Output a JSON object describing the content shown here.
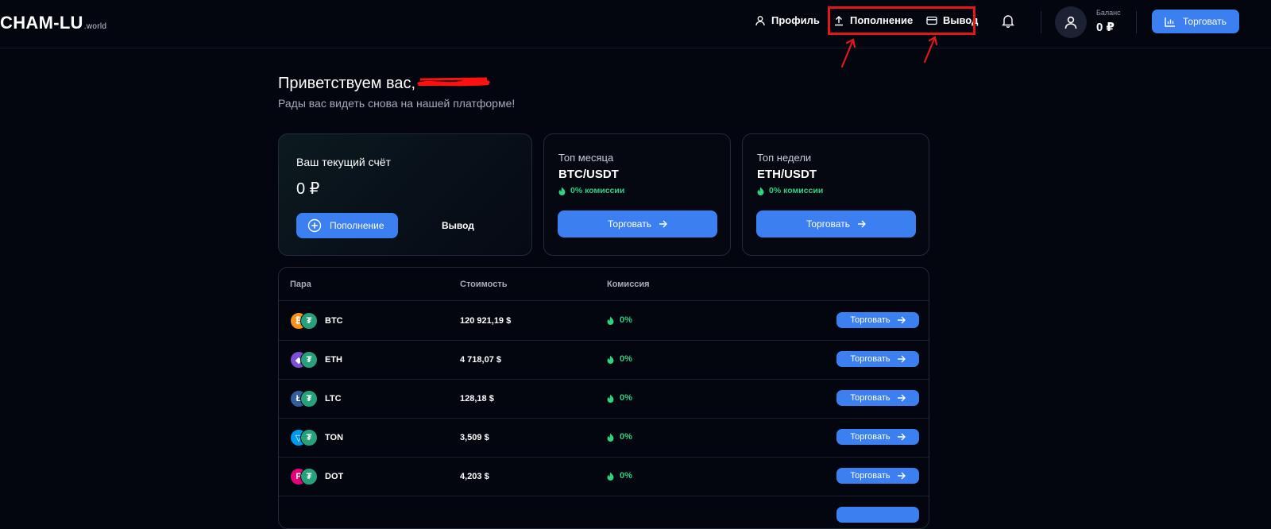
{
  "header": {
    "logo_main": "CHAM-LU",
    "logo_tld": ".world",
    "nav": {
      "profile_label": "Профиль",
      "deposit_label": "Пополнение",
      "withdraw_label": "Вывод"
    },
    "balance_label": "Баланс",
    "balance_value": "0 ₽",
    "trade_label": "Торговать"
  },
  "greeting": {
    "title": "Приветствуем вас,",
    "subtitle": "Рады вас видеть снова на нашей платформе!"
  },
  "account_card": {
    "title": "Ваш текущий счёт",
    "value": "0 ₽",
    "deposit_label": "Пополнение",
    "withdraw_label": "Вывод"
  },
  "top_cards": [
    {
      "label": "Топ месяца",
      "pair": "BTC/USDT",
      "fee": "0% комиссии",
      "button": "Торговать"
    },
    {
      "label": "Топ недели",
      "pair": "ETH/USDT",
      "fee": "0% комиссии",
      "button": "Торговать"
    }
  ],
  "table": {
    "headers": {
      "pair": "Пара",
      "price": "Стоимость",
      "fee": "Комиссия"
    },
    "rows": [
      {
        "symbol": "BTC",
        "price": "120 921,19 $",
        "fee": "0%",
        "button": "Торговать",
        "icon": "bitcoin-icon",
        "color": "#f7931a",
        "glyph": "₿"
      },
      {
        "symbol": "ETH",
        "price": "4 718,07 $",
        "fee": "0%",
        "button": "Торговать",
        "icon": "ethereum-icon",
        "color": "#7b4fd6",
        "glyph": "◆"
      },
      {
        "symbol": "LTC",
        "price": "128,18 $",
        "fee": "0%",
        "button": "Торговать",
        "icon": "litecoin-icon",
        "color": "#345d9d",
        "glyph": "Ł"
      },
      {
        "symbol": "TON",
        "price": "3,509 $",
        "fee": "0%",
        "button": "Торговать",
        "icon": "toncoin-icon",
        "color": "#0098ea",
        "glyph": "▽"
      },
      {
        "symbol": "DOT",
        "price": "4,203 $",
        "fee": "0%",
        "button": "Торговать",
        "icon": "polkadot-icon",
        "color": "#e6007a",
        "glyph": "P"
      }
    ]
  },
  "colors": {
    "accent": "#3b7ff0",
    "success": "#2fd27f",
    "background": "#03050f",
    "annotation": "#e2161b"
  }
}
